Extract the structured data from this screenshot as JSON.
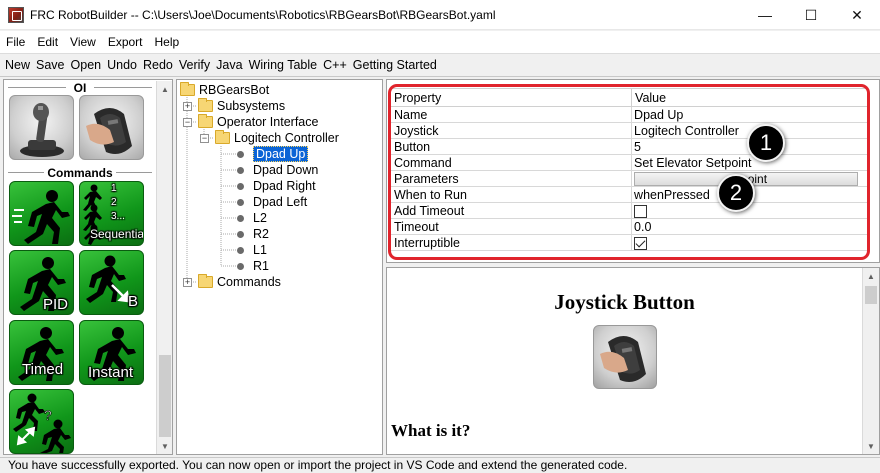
{
  "window": {
    "title": "FRC RobotBuilder -- C:\\Users\\Joe\\Documents\\Robotics\\RBGearsBot\\RBGearsBot.yaml",
    "controls": {
      "minimize": "—",
      "maximize": "☐",
      "close": "✕"
    }
  },
  "menu": [
    "File",
    "Edit",
    "View",
    "Export",
    "Help"
  ],
  "toolbar": [
    "New",
    "Save",
    "Open",
    "Undo",
    "Redo",
    "Verify",
    "Java",
    "Wiring Table",
    "C++",
    "Getting Started"
  ],
  "palette": {
    "oi_title": "OI",
    "commands_title": "Commands",
    "tiles": {
      "sequential_numbers": [
        "1",
        "2",
        "3..."
      ],
      "sequential": "Sequentia",
      "pid": "PID",
      "b": "B",
      "timed": "Timed",
      "instant": "Instant"
    }
  },
  "tree": {
    "root": "RBGearsBot",
    "subsystems": "Subsystems",
    "operator_interface": "Operator Interface",
    "controller": "Logitech Controller",
    "buttons": [
      "Dpad Up",
      "Dpad Down",
      "Dpad Right",
      "Dpad Left",
      "L2",
      "R2",
      "L1",
      "R1"
    ],
    "commands": "Commands",
    "selected": "Dpad Up"
  },
  "properties": {
    "header": {
      "property": "Property",
      "value": "Value"
    },
    "rows": [
      {
        "name": "Name",
        "value": "Dpad Up"
      },
      {
        "name": "Joystick",
        "value": "Logitech Controller"
      },
      {
        "name": "Button",
        "value": "5"
      },
      {
        "name": "Command",
        "value": "Set Elevator Setpoint"
      },
      {
        "name": "Parameters",
        "value": "setpoint"
      },
      {
        "name": "When to Run",
        "value": "whenPressed"
      },
      {
        "name": "Add Timeout",
        "value": ""
      },
      {
        "name": "Timeout",
        "value": "0.0"
      },
      {
        "name": "Interruptible",
        "value": ""
      }
    ],
    "add_timeout_checked": false,
    "interruptible_checked": true,
    "callouts": [
      "1",
      "2"
    ],
    "highlight_color": "#e0242c"
  },
  "help": {
    "title": "Joystick Button",
    "subtitle": "What is it?"
  },
  "status": "You have successfully exported. You can now open or import the project in VS Code and extend the generated code."
}
